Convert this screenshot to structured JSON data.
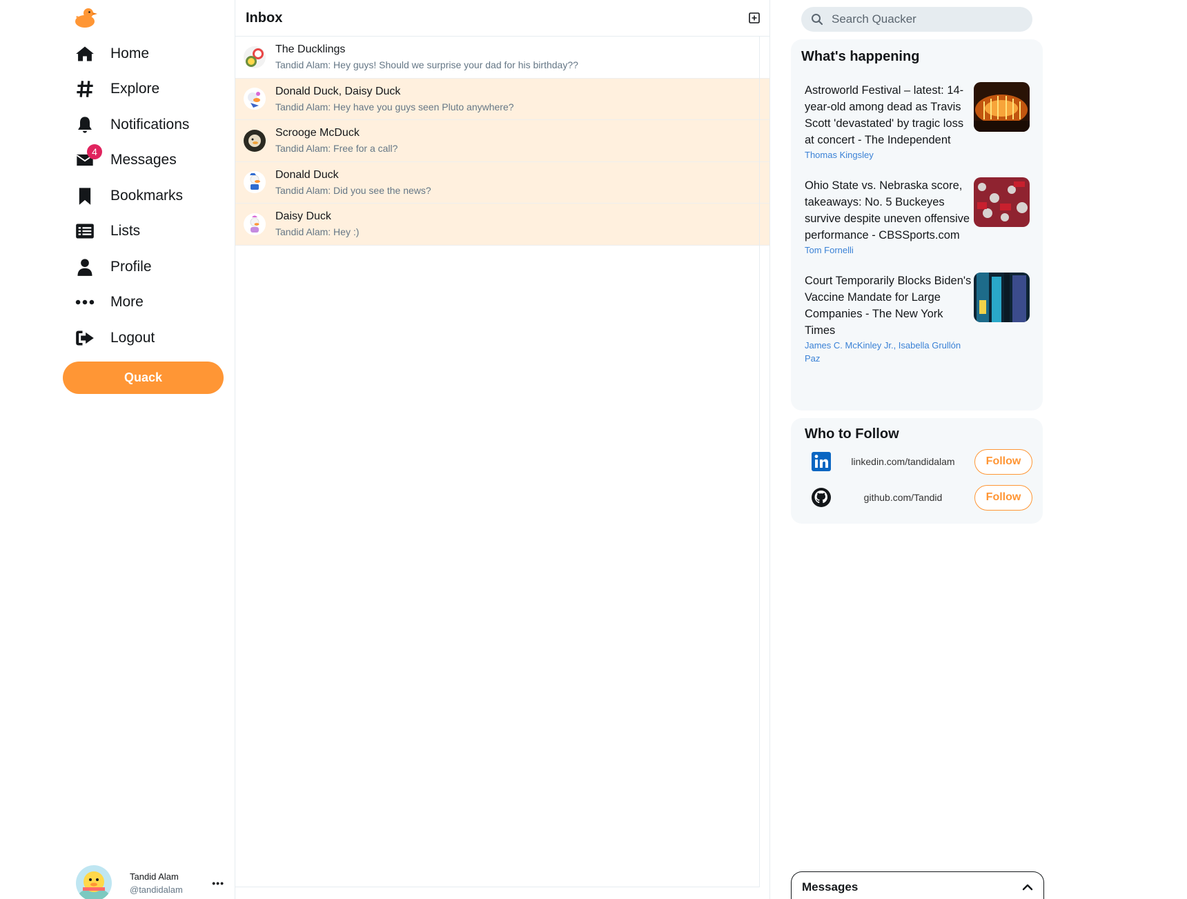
{
  "sidebar": {
    "nav": [
      {
        "label": "Home",
        "icon": "home-icon"
      },
      {
        "label": "Explore",
        "icon": "hashtag-icon"
      },
      {
        "label": "Notifications",
        "icon": "bell-icon"
      },
      {
        "label": "Messages",
        "icon": "envelope-icon",
        "badge": "4"
      },
      {
        "label": "Bookmarks",
        "icon": "bookmark-icon"
      },
      {
        "label": "Lists",
        "icon": "list-icon"
      },
      {
        "label": "Profile",
        "icon": "user-icon"
      },
      {
        "label": "More",
        "icon": "ellipsis-icon"
      },
      {
        "label": "Logout",
        "icon": "logout-icon"
      }
    ],
    "quack_label": "Quack",
    "user": {
      "name": "Tandid Alam",
      "handle": "@tandidalam",
      "more": "•••"
    }
  },
  "inbox": {
    "title": "Inbox",
    "threads": [
      {
        "name": "The Ducklings",
        "preview": "Tandid Alam: Hey guys! Should we surprise your dad for his birthday??",
        "unread": false
      },
      {
        "name": "Donald Duck, Daisy Duck",
        "preview": "Tandid Alam: Hey have you guys seen Pluto anywhere?",
        "unread": true
      },
      {
        "name": "Scrooge McDuck",
        "preview": "Tandid Alam: Free for a call?",
        "unread": true
      },
      {
        "name": "Donald Duck",
        "preview": "Tandid Alam: Did you see the news?",
        "unread": true
      },
      {
        "name": "Daisy Duck",
        "preview": "Tandid Alam: Hey :)",
        "unread": true
      }
    ]
  },
  "right": {
    "search_placeholder": "Search Quacker",
    "happening": {
      "title": "What's happening",
      "items": [
        {
          "headline": "Astroworld Festival – latest: 14-year-old among dead as Travis Scott 'devastated' by tragic loss at concert - The Independent",
          "author": "Thomas Kingsley"
        },
        {
          "headline": "Ohio State vs. Nebraska score, takeaways: No. 5 Buckeyes survive despite uneven offensive performance - CBSSports.com",
          "author": "Tom Fornelli"
        },
        {
          "headline": "Court Temporarily Blocks Biden's Vaccine Mandate for Large Companies - The New York Times",
          "author": "James C. McKinley Jr., Isabella Grullón Paz"
        }
      ]
    },
    "follow": {
      "title": "Who to Follow",
      "items": [
        {
          "url": "linkedin.com/tandidalam",
          "button": "Follow",
          "icon": "linkedin-icon"
        },
        {
          "url": "github.com/Tandid",
          "button": "Follow",
          "icon": "github-icon"
        }
      ]
    },
    "messages_dock": "Messages"
  },
  "colors": {
    "accent": "#ff9635",
    "unread_bg": "#fff0de",
    "badge": "#e0245e",
    "link": "#3b82d6"
  }
}
